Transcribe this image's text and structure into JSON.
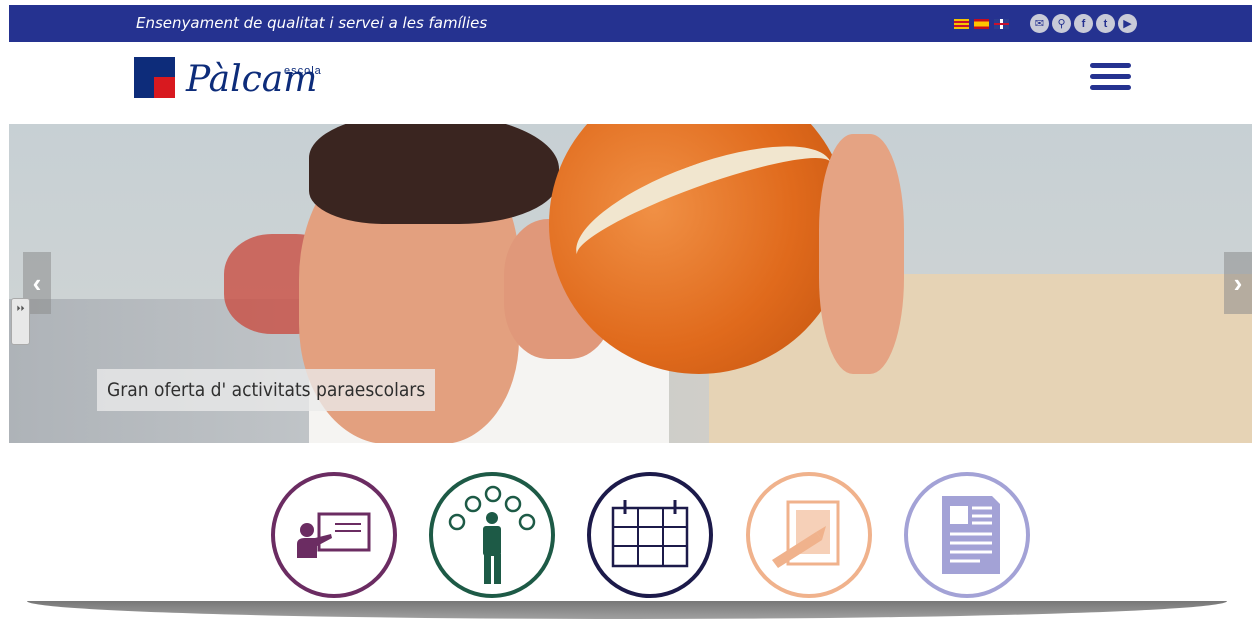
{
  "topbar": {
    "tagline": "Ensenyament de qualitat i servei a les famílies",
    "flags": [
      {
        "name": "flag-catalan",
        "colors": [
          "#f5c400",
          "#c8102e"
        ]
      },
      {
        "name": "flag-spanish",
        "colors": [
          "#c60b1e",
          "#ffc400"
        ]
      },
      {
        "name": "flag-english",
        "colors": [
          "#2b3d8f",
          "#c8102e"
        ]
      }
    ],
    "socials": [
      {
        "icon": "email-icon",
        "glyph": "✉"
      },
      {
        "icon": "location-icon",
        "glyph": "⚲"
      },
      {
        "icon": "facebook-icon",
        "glyph": "f"
      },
      {
        "icon": "twitter-icon",
        "glyph": "t"
      },
      {
        "icon": "youtube-icon",
        "glyph": "▶"
      }
    ],
    "background": "#253290"
  },
  "header": {
    "logo_small": "escola",
    "logo_name": "Pàlcam",
    "menu_icon": "hamburger-icon"
  },
  "hero": {
    "caption": "Gran oferta d' activitats paraescolars",
    "prev_glyph": "‹",
    "next_glyph": "›",
    "side_handle_glyph": "⏵⏵"
  },
  "features": [
    {
      "icon": "teacher-board-icon",
      "color": "#6b2c62"
    },
    {
      "icon": "network-person-icon",
      "color": "#1d5a46"
    },
    {
      "icon": "calendar-icon",
      "color": "#1c1a4a"
    },
    {
      "icon": "note-pencil-icon",
      "color": "#f0b28c"
    },
    {
      "icon": "document-icon",
      "color": "#a3a2d6"
    }
  ]
}
